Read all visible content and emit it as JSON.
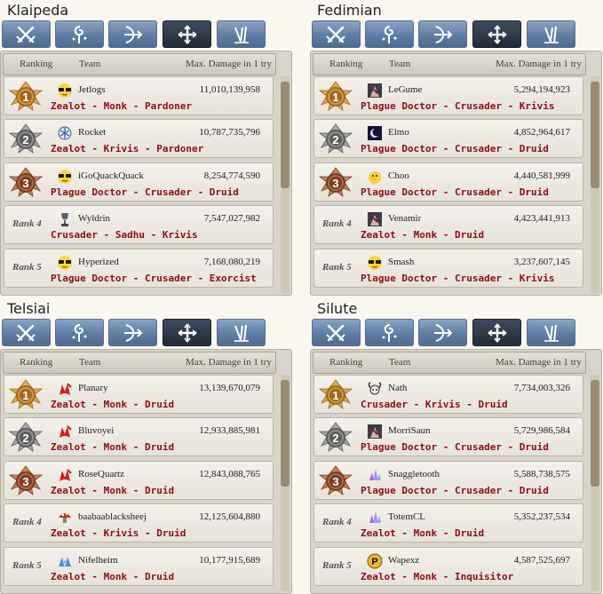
{
  "colors": {
    "composition_text": "#8b0f15",
    "tab_blue": "#5f7ea6",
    "tab_active": "#2a3442",
    "gold": "#c79a3e",
    "silver": "#8e8e8e",
    "bronze": "#a6603a"
  },
  "header": {
    "ranking": "Ranking",
    "team": "Team",
    "damage": "Max. Damage in 1 try"
  },
  "tabs": [
    {
      "name": "swords",
      "icon": "crossed-swords-icon"
    },
    {
      "name": "wizard",
      "icon": "wizard-swirl-icon"
    },
    {
      "name": "archer",
      "icon": "bow-icon"
    },
    {
      "name": "cleric",
      "icon": "cleric-cross-icon"
    },
    {
      "name": "scout",
      "icon": "scout-dagger-icon"
    }
  ],
  "servers": [
    {
      "name": "Klaipeda",
      "rows": [
        {
          "rank_label": "",
          "team": "Jetlogs",
          "icon": "sunglasses-emoji-icon",
          "damage": "11,010,139,958",
          "composition": "Zealot - Monk - Pardoner"
        },
        {
          "rank_label": "",
          "team": "Rocket",
          "icon": "snowflake-badge-icon",
          "damage": "10,787,735,796",
          "composition": "Zealot - Krivis - Pardoner"
        },
        {
          "rank_label": "",
          "team": "iGoQuackQuack",
          "icon": "sunglasses-emoji-icon",
          "damage": "8,254,774,590",
          "composition": "Plague Doctor - Crusader - Druid"
        },
        {
          "rank_label": "Rank 4",
          "team": "Wyldrin",
          "icon": "trophy-icon",
          "damage": "7,547,027,982",
          "composition": "Crusader - Sadhu - Krivis"
        },
        {
          "rank_label": "Rank 5",
          "team": "Hyperized",
          "icon": "sunglasses-emoji-icon",
          "damage": "7,168,080,219",
          "composition": "Plague Doctor - Crusader - Exorcist"
        }
      ]
    },
    {
      "name": "Fedimian",
      "rows": [
        {
          "rank_label": "",
          "team": "LeGume",
          "icon": "character-portrait-icon",
          "damage": "5,294,194,923",
          "composition": "Plague Doctor - Crusader - Krivis"
        },
        {
          "rank_label": "",
          "team": "Elmo",
          "icon": "moon-icon",
          "damage": "4,852,964,617",
          "composition": "Plague Doctor - Crusader - Druid"
        },
        {
          "rank_label": "",
          "team": "Choo",
          "icon": "chick-icon",
          "damage": "4,440,581,999",
          "composition": "Plague Doctor - Crusader - Druid"
        },
        {
          "rank_label": "Rank 4",
          "team": "Venamir",
          "icon": "character-portrait-icon",
          "damage": "4,423,441,913",
          "composition": "Zealot - Monk - Druid"
        },
        {
          "rank_label": "Rank 5",
          "team": "Smash",
          "icon": "sunglasses-emoji-icon",
          "damage": "3,237,607,145",
          "composition": "Plague Doctor - Crusader - Krivis"
        }
      ]
    },
    {
      "name": "Telsiai",
      "rows": [
        {
          "rank_label": "",
          "team": "Planary",
          "icon": "red-dragon-icon",
          "damage": "13,139,670,079",
          "composition": "Zealot - Monk - Druid"
        },
        {
          "rank_label": "",
          "team": "Bluvoyei",
          "icon": "red-dragon-icon",
          "damage": "12,933,885,981",
          "composition": "Zealot - Monk - Druid"
        },
        {
          "rank_label": "",
          "team": "RoseQuartz",
          "icon": "red-dragon-icon",
          "damage": "12,843,088,765",
          "composition": "Zealot - Monk - Druid"
        },
        {
          "rank_label": "Rank 4",
          "team": "baabaablacksheej",
          "icon": "mushroom-icon",
          "damage": "12,125,604,880",
          "composition": "Zealot - Krivis - Druid"
        },
        {
          "rank_label": "Rank 5",
          "team": "Nifelheim",
          "icon": "blue-crystal-icon",
          "damage": "10,177,915,689",
          "composition": "Zealot - Monk - Druid"
        }
      ]
    },
    {
      "name": "Silute",
      "rows": [
        {
          "rank_label": "",
          "team": "Nath",
          "icon": "horned-skull-icon",
          "damage": "7,734,003,326",
          "composition": "Crusader - Krivis - Druid"
        },
        {
          "rank_label": "",
          "team": "MorriSaun",
          "icon": "character-portrait-icon",
          "damage": "5,729,986,584",
          "composition": "Plague Doctor - Crusader - Druid"
        },
        {
          "rank_label": "",
          "team": "Snaggletooth",
          "icon": "crystal-cluster-icon",
          "damage": "5,588,738,575",
          "composition": "Plague Doctor - Crusader - Druid"
        },
        {
          "rank_label": "Rank 4",
          "team": "TotemCL",
          "icon": "crystal-cluster-icon",
          "damage": "5,352,237,534",
          "composition": "Zealot - Monk - Druid"
        },
        {
          "rank_label": "Rank 5",
          "team": "Wapexz",
          "icon": "gold-coin-p-icon",
          "damage": "4,587,525,697",
          "composition": "Zealot - Monk - Inquisitor"
        }
      ]
    }
  ]
}
